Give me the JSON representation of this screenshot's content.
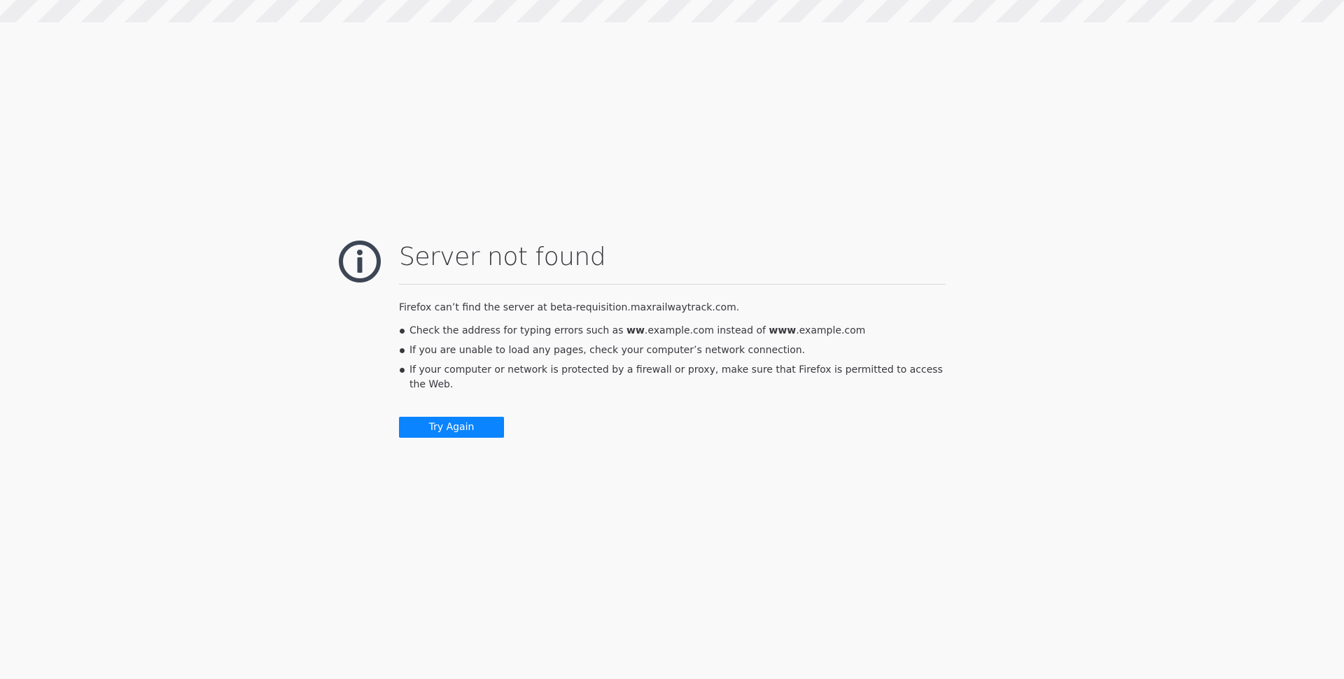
{
  "page": {
    "title": "Server not found",
    "description": "Firefox can’t find the server at beta-requisition.maxrailwaytrack.com."
  },
  "suggestions": {
    "item1": {
      "prefix": "Check the address for typing errors such as ",
      "bold1": "ww",
      "middle": ".example.com instead of ",
      "bold2": "www",
      "suffix": ".example.com"
    },
    "item2": "If you are unable to load any pages, check your computer’s network connection.",
    "item3": "If your computer or network is protected by a firewall or proxy, make sure that Firefox is permitted to access the Web."
  },
  "actions": {
    "try_again_label": "Try Again"
  },
  "icons": {
    "info": "info-icon"
  },
  "colors": {
    "accent": "#0a84ff",
    "text": "#38383d",
    "background": "#f9f9fa"
  }
}
